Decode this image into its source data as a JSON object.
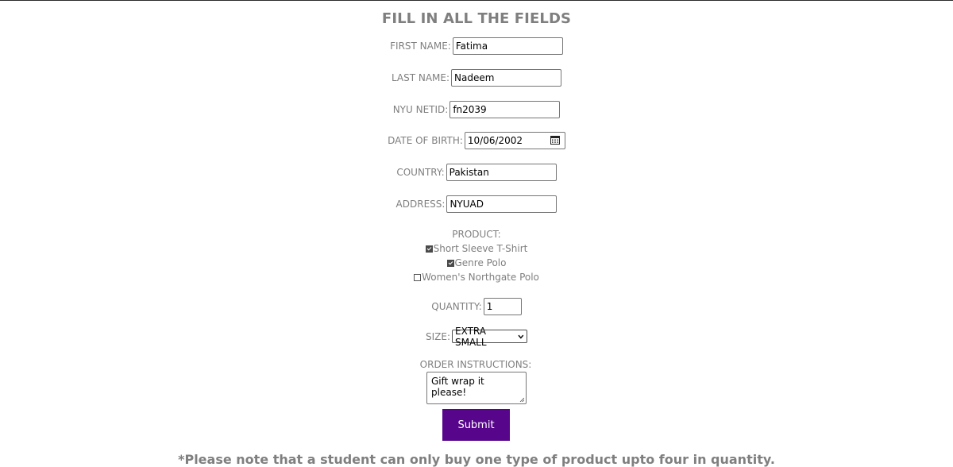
{
  "form": {
    "title": "FILL IN ALL THE FIELDS",
    "first_name": {
      "label": "FIRST NAME:",
      "value": "Fatima"
    },
    "last_name": {
      "label": "LAST NAME:",
      "value": "Nadeem"
    },
    "netid": {
      "label": "NYU NETID:",
      "value": "fn2039"
    },
    "dob": {
      "label": "DATE OF BIRTH:",
      "value": "10/06/2002",
      "icon": "calendar-icon"
    },
    "country": {
      "label": "COUNTRY:",
      "value": "Pakistan"
    },
    "address": {
      "label": "ADDRESS:",
      "value": "NYUAD"
    },
    "product": {
      "label": "PRODUCT:",
      "options": [
        {
          "label": "Short Sleeve T-Shirt",
          "checked": true
        },
        {
          "label": "Genre Polo",
          "checked": true
        },
        {
          "label": "Women's Northgate Polo",
          "checked": false
        }
      ]
    },
    "quantity": {
      "label": "QUANTITY:",
      "value": "1"
    },
    "size": {
      "label": "SIZE:",
      "value": "EXTRA SMALL",
      "icon": "chevron-down-icon"
    },
    "instructions": {
      "label": "ORDER INSTRUCTIONS:",
      "value": "Gift wrap it please!"
    },
    "submit_label": "Submit",
    "note": "*Please note that a student can only buy one type of product upto four in quantity."
  },
  "colors": {
    "accent": "#57068c",
    "label_text": "#7f7f7f"
  }
}
